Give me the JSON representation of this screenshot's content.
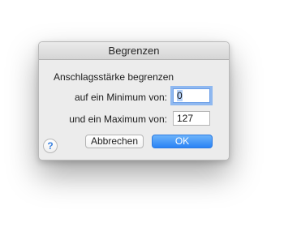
{
  "dialog": {
    "title": "Begrenzen",
    "heading": "Anschlagsstärke begrenzen",
    "min_label": "auf ein Minimum von:",
    "min_value": "0",
    "max_label": "und ein Maximum von:",
    "max_value": "127",
    "help_label": "?",
    "cancel_label": "Abbrechen",
    "ok_label": "OK"
  },
  "colors": {
    "accent": "#2a83f5",
    "focus_ring": "#8fb8f0",
    "window_bg": "#ececec"
  },
  "icons": {
    "help": "help-icon"
  }
}
